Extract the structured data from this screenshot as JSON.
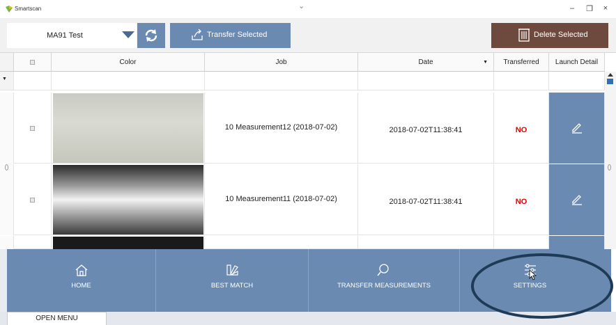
{
  "window": {
    "title": "Smartscan",
    "minimize_glyph": "–",
    "maximize_glyph": "❐",
    "close_glyph": "×"
  },
  "toolbar": {
    "device": "MA91 Test",
    "transfer_label": "Transfer Selected",
    "delete_label": "Delete Selected"
  },
  "table": {
    "columns": [
      "Color",
      "Job",
      "Date",
      "Transferred",
      "Launch Detail"
    ],
    "rows": [
      {
        "job": "10 Measurement12 (2018-07-02)",
        "date": "2018-07-02T11:38:41",
        "transferred": "NO"
      },
      {
        "job": "10 Measurement11 (2018-07-02)",
        "date": "2018-07-02T11:38:41",
        "transferred": "NO"
      }
    ]
  },
  "nav": {
    "items": [
      {
        "label": "HOME",
        "icon": "home-icon"
      },
      {
        "label": "BEST MATCH",
        "icon": "color-fan-icon"
      },
      {
        "label": "TRANSFER MEASUREMENTS",
        "icon": "search-icon"
      },
      {
        "label": "SETTINGS",
        "icon": "sliders-icon"
      }
    ]
  },
  "footer": {
    "open_menu": "OPEN MENU"
  },
  "colors": {
    "primary": "#6a8ab2",
    "delete": "#6e4a3e",
    "alert_red": "#e00000"
  }
}
